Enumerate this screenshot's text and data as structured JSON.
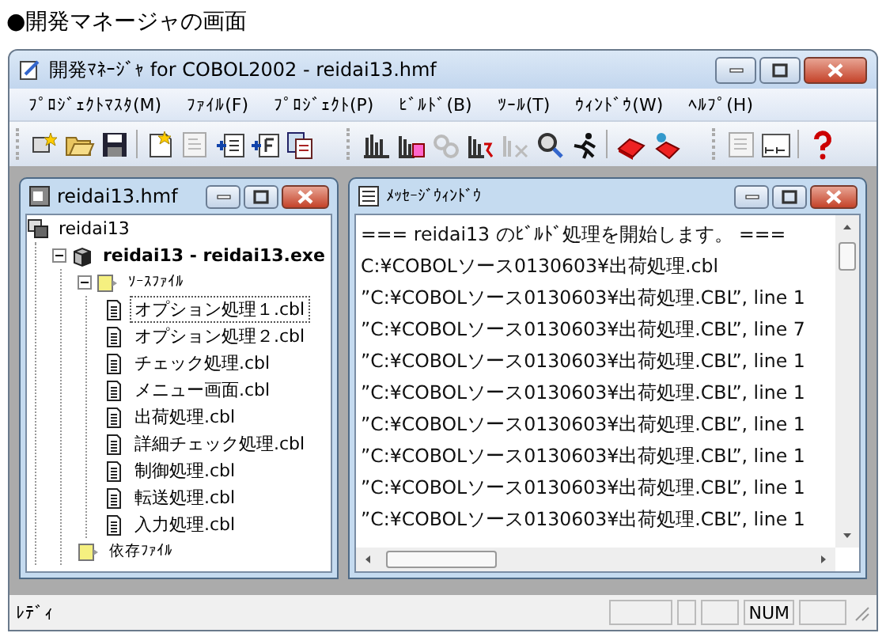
{
  "heading": "●開発マネージャの画面",
  "window": {
    "title": "開発ﾏﾈｰｼﾞｬ for COBOL2002 - reidai13.hmf"
  },
  "menu": [
    "ﾌﾟﾛｼﾞｪｸﾄﾏｽﾀ(M)",
    "ﾌｧｲﾙ(F)",
    "ﾌﾟﾛｼﾞｪｸﾄ(P)",
    "ﾋﾞﾙﾄﾞ(B)",
    "ﾂｰﾙ(T)",
    "ｳｨﾝﾄﾞｳ(W)",
    "ﾍﾙﾌﾟ(H)"
  ],
  "project_window": {
    "title": "reidai13.hmf",
    "tree": [
      {
        "label": "reidai13",
        "kind": "master",
        "children": [
          {
            "label": "reidai13 - reidai13.exe",
            "kind": "exe",
            "expanded": true,
            "children": [
              {
                "label": "ｿｰｽﾌｧｲﾙ",
                "kind": "folder",
                "expanded": true,
                "children": [
                  {
                    "label": "オプション処理１.cbl",
                    "kind": "file",
                    "selected": true
                  },
                  {
                    "label": "オプション処理２.cbl",
                    "kind": "file",
                    "selected": false
                  },
                  {
                    "label": "チェック処理.cbl",
                    "kind": "file",
                    "selected": false
                  },
                  {
                    "label": "メニュー画面.cbl",
                    "kind": "file",
                    "selected": false
                  },
                  {
                    "label": "出荷処理.cbl",
                    "kind": "file",
                    "selected": false
                  },
                  {
                    "label": "詳細チェック処理.cbl",
                    "kind": "file",
                    "selected": false
                  },
                  {
                    "label": "制御処理.cbl",
                    "kind": "file",
                    "selected": false
                  },
                  {
                    "label": "転送処理.cbl",
                    "kind": "file",
                    "selected": false
                  },
                  {
                    "label": "入力処理.cbl",
                    "kind": "file",
                    "selected": false
                  }
                ]
              },
              {
                "label": "依存ﾌｧｲﾙ",
                "kind": "folder"
              }
            ]
          }
        ]
      }
    ]
  },
  "message_window": {
    "title": "ﾒｯｾｰｼﾞｳｨﾝﾄﾞｳ",
    "lines": [
      "=== reidai13 のﾋﾞﾙﾄﾞ処理を開始します。 ===",
      "C:¥COBOLソース0130603¥出荷処理.cbl",
      "”C:¥COBOLソース0130603¥出荷処理.CBL”, line 1",
      "”C:¥COBOLソース0130603¥出荷処理.CBL”, line 7",
      "”C:¥COBOLソース0130603¥出荷処理.CBL”, line 1",
      "”C:¥COBOLソース0130603¥出荷処理.CBL”, line 1",
      "”C:¥COBOLソース0130603¥出荷処理.CBL”, line 1",
      "”C:¥COBOLソース0130603¥出荷処理.CBL”, line 1",
      "”C:¥COBOLソース0130603¥出荷処理.CBL”, line 1",
      "”C:¥COBOLソース0130603¥出荷処理.CBL”, line 1"
    ]
  },
  "status_bar": {
    "text": "ﾚﾃﾞｨ",
    "indicator": "NUM"
  }
}
